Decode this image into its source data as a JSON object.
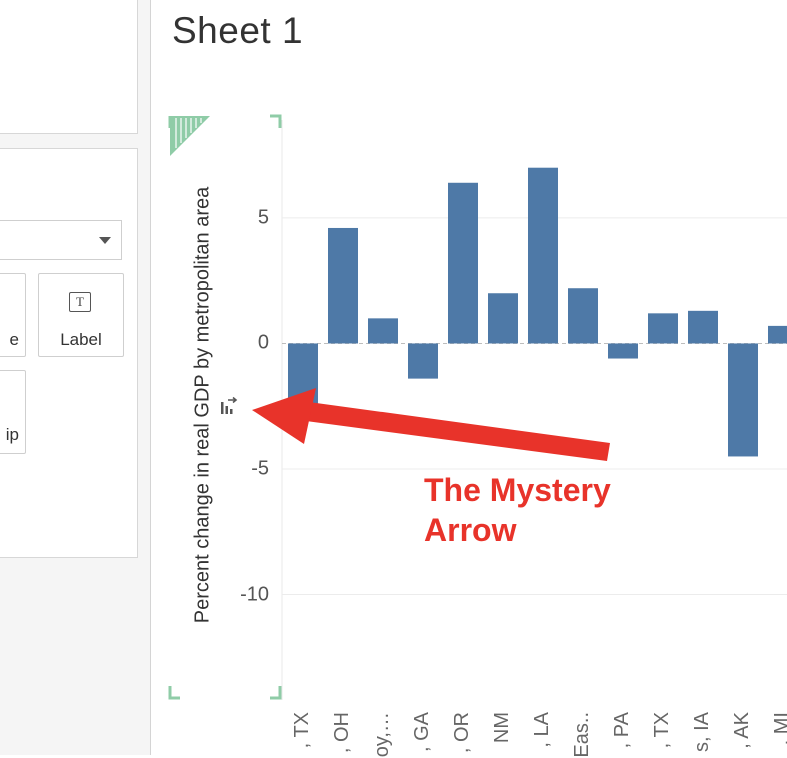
{
  "sheet": {
    "title": "Sheet 1"
  },
  "marks_panel": {
    "size_label": "e",
    "label_label": "Label",
    "tooltip_label": "ip",
    "label_icon_glyph": "T"
  },
  "colors": {
    "bar": "#4e79a7",
    "annotation": "#e8332a",
    "corner": "#8fcca7"
  },
  "annotation": {
    "line1": "The Mystery",
    "line2": "Arrow"
  },
  "chart_data": {
    "type": "bar",
    "ylabel": "Percent change in real GDP by metropolitan area",
    "ylim": [
      -14.2,
      8.9
    ],
    "yticks": [
      {
        "value": 5,
        "label": "5"
      },
      {
        "value": 0,
        "label": "0"
      },
      {
        "value": -5,
        "label": "-5"
      },
      {
        "value": -10,
        "label": "-10"
      }
    ],
    "categories": [
      ", TX",
      ", OH",
      "oy,…",
      ", GA",
      ", OR",
      "NM",
      ", LA",
      "Eas..",
      ", PA",
      ", TX",
      "s, IA",
      ", AK",
      ", MI"
    ],
    "values": [
      -2.9,
      4.6,
      1.0,
      -1.4,
      6.4,
      2.0,
      7.0,
      2.2,
      -0.6,
      1.2,
      1.3,
      -4.5,
      0.7
    ],
    "grid": true
  }
}
